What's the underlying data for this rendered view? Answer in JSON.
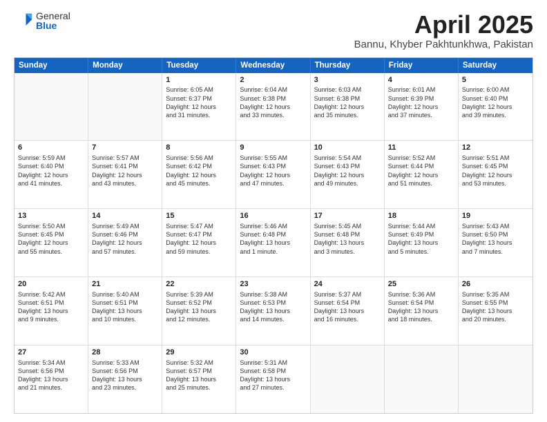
{
  "logo": {
    "general": "General",
    "blue": "Blue"
  },
  "title": {
    "month": "April 2025",
    "location": "Bannu, Khyber Pakhtunkhwa, Pakistan"
  },
  "calendar": {
    "headers": [
      "Sunday",
      "Monday",
      "Tuesday",
      "Wednesday",
      "Thursday",
      "Friday",
      "Saturday"
    ],
    "weeks": [
      [
        {
          "day": "",
          "text": ""
        },
        {
          "day": "",
          "text": ""
        },
        {
          "day": "1",
          "text": "Sunrise: 6:05 AM\nSunset: 6:37 PM\nDaylight: 12 hours\nand 31 minutes."
        },
        {
          "day": "2",
          "text": "Sunrise: 6:04 AM\nSunset: 6:38 PM\nDaylight: 12 hours\nand 33 minutes."
        },
        {
          "day": "3",
          "text": "Sunrise: 6:03 AM\nSunset: 6:38 PM\nDaylight: 12 hours\nand 35 minutes."
        },
        {
          "day": "4",
          "text": "Sunrise: 6:01 AM\nSunset: 6:39 PM\nDaylight: 12 hours\nand 37 minutes."
        },
        {
          "day": "5",
          "text": "Sunrise: 6:00 AM\nSunset: 6:40 PM\nDaylight: 12 hours\nand 39 minutes."
        }
      ],
      [
        {
          "day": "6",
          "text": "Sunrise: 5:59 AM\nSunset: 6:40 PM\nDaylight: 12 hours\nand 41 minutes."
        },
        {
          "day": "7",
          "text": "Sunrise: 5:57 AM\nSunset: 6:41 PM\nDaylight: 12 hours\nand 43 minutes."
        },
        {
          "day": "8",
          "text": "Sunrise: 5:56 AM\nSunset: 6:42 PM\nDaylight: 12 hours\nand 45 minutes."
        },
        {
          "day": "9",
          "text": "Sunrise: 5:55 AM\nSunset: 6:43 PM\nDaylight: 12 hours\nand 47 minutes."
        },
        {
          "day": "10",
          "text": "Sunrise: 5:54 AM\nSunset: 6:43 PM\nDaylight: 12 hours\nand 49 minutes."
        },
        {
          "day": "11",
          "text": "Sunrise: 5:52 AM\nSunset: 6:44 PM\nDaylight: 12 hours\nand 51 minutes."
        },
        {
          "day": "12",
          "text": "Sunrise: 5:51 AM\nSunset: 6:45 PM\nDaylight: 12 hours\nand 53 minutes."
        }
      ],
      [
        {
          "day": "13",
          "text": "Sunrise: 5:50 AM\nSunset: 6:45 PM\nDaylight: 12 hours\nand 55 minutes."
        },
        {
          "day": "14",
          "text": "Sunrise: 5:49 AM\nSunset: 6:46 PM\nDaylight: 12 hours\nand 57 minutes."
        },
        {
          "day": "15",
          "text": "Sunrise: 5:47 AM\nSunset: 6:47 PM\nDaylight: 12 hours\nand 59 minutes."
        },
        {
          "day": "16",
          "text": "Sunrise: 5:46 AM\nSunset: 6:48 PM\nDaylight: 13 hours\nand 1 minute."
        },
        {
          "day": "17",
          "text": "Sunrise: 5:45 AM\nSunset: 6:48 PM\nDaylight: 13 hours\nand 3 minutes."
        },
        {
          "day": "18",
          "text": "Sunrise: 5:44 AM\nSunset: 6:49 PM\nDaylight: 13 hours\nand 5 minutes."
        },
        {
          "day": "19",
          "text": "Sunrise: 5:43 AM\nSunset: 6:50 PM\nDaylight: 13 hours\nand 7 minutes."
        }
      ],
      [
        {
          "day": "20",
          "text": "Sunrise: 5:42 AM\nSunset: 6:51 PM\nDaylight: 13 hours\nand 9 minutes."
        },
        {
          "day": "21",
          "text": "Sunrise: 5:40 AM\nSunset: 6:51 PM\nDaylight: 13 hours\nand 10 minutes."
        },
        {
          "day": "22",
          "text": "Sunrise: 5:39 AM\nSunset: 6:52 PM\nDaylight: 13 hours\nand 12 minutes."
        },
        {
          "day": "23",
          "text": "Sunrise: 5:38 AM\nSunset: 6:53 PM\nDaylight: 13 hours\nand 14 minutes."
        },
        {
          "day": "24",
          "text": "Sunrise: 5:37 AM\nSunset: 6:54 PM\nDaylight: 13 hours\nand 16 minutes."
        },
        {
          "day": "25",
          "text": "Sunrise: 5:36 AM\nSunset: 6:54 PM\nDaylight: 13 hours\nand 18 minutes."
        },
        {
          "day": "26",
          "text": "Sunrise: 5:35 AM\nSunset: 6:55 PM\nDaylight: 13 hours\nand 20 minutes."
        }
      ],
      [
        {
          "day": "27",
          "text": "Sunrise: 5:34 AM\nSunset: 6:56 PM\nDaylight: 13 hours\nand 21 minutes."
        },
        {
          "day": "28",
          "text": "Sunrise: 5:33 AM\nSunset: 6:56 PM\nDaylight: 13 hours\nand 23 minutes."
        },
        {
          "day": "29",
          "text": "Sunrise: 5:32 AM\nSunset: 6:57 PM\nDaylight: 13 hours\nand 25 minutes."
        },
        {
          "day": "30",
          "text": "Sunrise: 5:31 AM\nSunset: 6:58 PM\nDaylight: 13 hours\nand 27 minutes."
        },
        {
          "day": "",
          "text": ""
        },
        {
          "day": "",
          "text": ""
        },
        {
          "day": "",
          "text": ""
        }
      ]
    ]
  }
}
